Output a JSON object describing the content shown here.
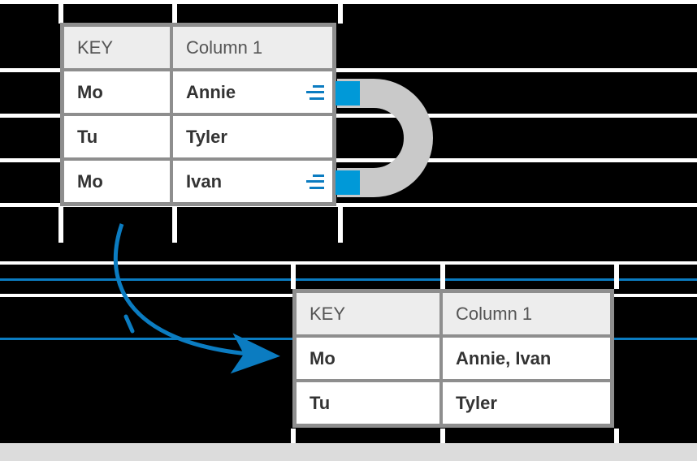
{
  "colors": {
    "accent": "#0099d8",
    "line_accent": "#0b7cc1",
    "table_border": "#8e8e8e",
    "header_bg": "#ededed"
  },
  "top_table": {
    "header": {
      "key": "KEY",
      "col1": "Column 1"
    },
    "rows": [
      {
        "key": "Mo",
        "col1": "Annie",
        "has_merge_icon": true
      },
      {
        "key": "Tu",
        "col1": "Tyler",
        "has_merge_icon": false
      },
      {
        "key": "Mo",
        "col1": "Ivan",
        "has_merge_icon": true
      }
    ]
  },
  "bottom_table": {
    "header": {
      "key": "KEY",
      "col1": "Column 1"
    },
    "rows": [
      {
        "key": "Mo",
        "col1": "Annie, Ivan"
      },
      {
        "key": "Tu",
        "col1": "Tyler"
      }
    ]
  },
  "icons": {
    "merge": "merge-lines-icon",
    "arrow": "curved-arrow-icon",
    "u_connector": "u-connector-icon"
  }
}
